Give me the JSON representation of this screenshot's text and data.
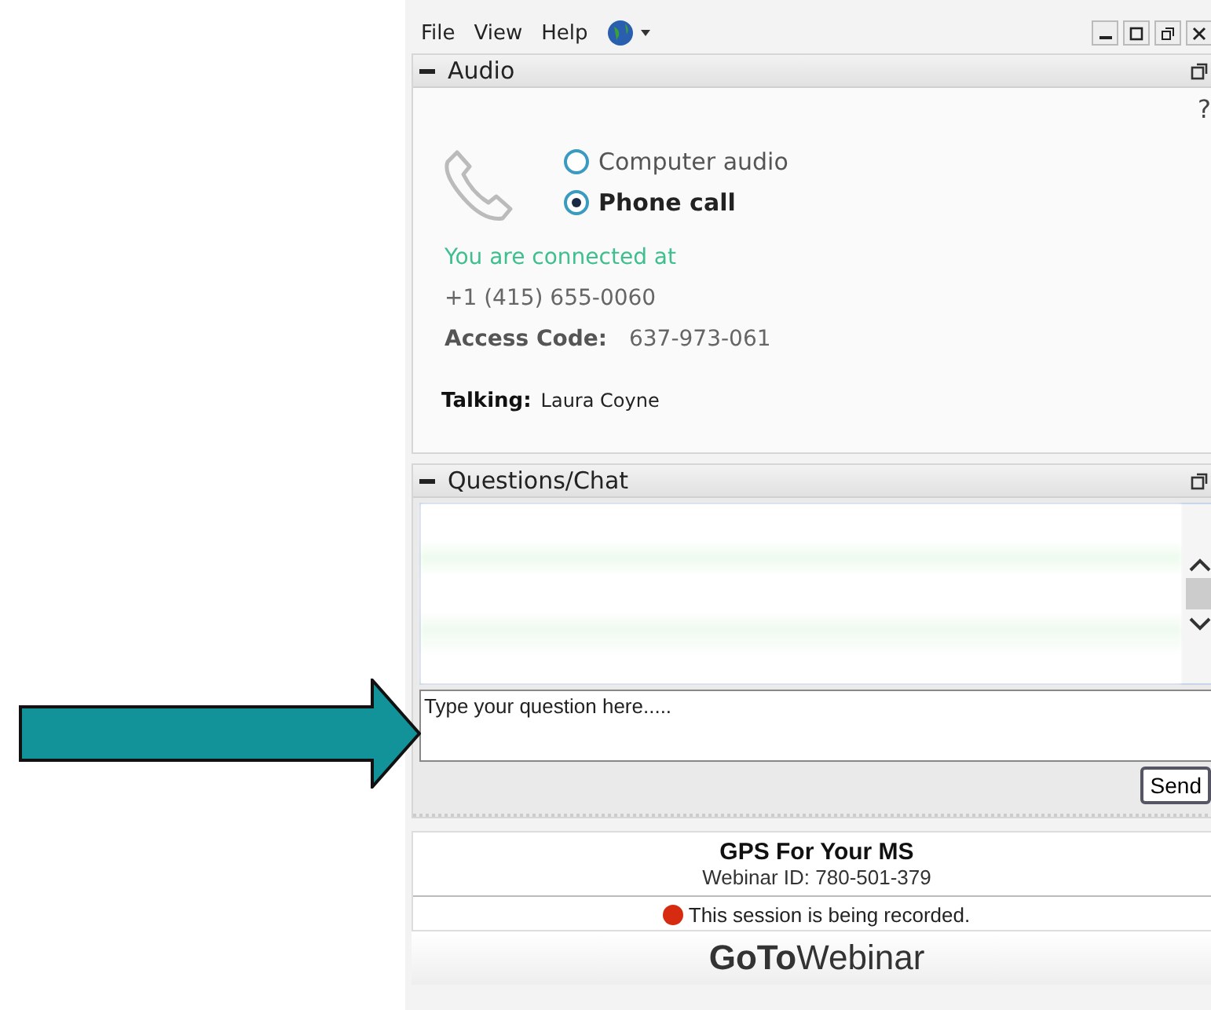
{
  "menu": [
    "File",
    "View",
    "Help"
  ],
  "audio": {
    "title": "Audio",
    "help": "?",
    "options": [
      {
        "label": "Computer audio",
        "selected": false
      },
      {
        "label": "Phone call",
        "selected": true
      }
    ],
    "status": "You are connected at",
    "phone": "+1 (415) 655-0060",
    "access_label": "Access Code:",
    "access_code": "637-973-061",
    "talking_label": "Talking:",
    "talking_name": "Laura Coyne"
  },
  "chat": {
    "title": "Questions/Chat",
    "placeholder": "Type your question here.....",
    "send": "Send"
  },
  "info": {
    "title": "GPS For Your MS",
    "webinar_id": "Webinar ID: 780-501-379",
    "recording": "This session is being recorded."
  },
  "brand": "**GoTo**Webinar"
}
